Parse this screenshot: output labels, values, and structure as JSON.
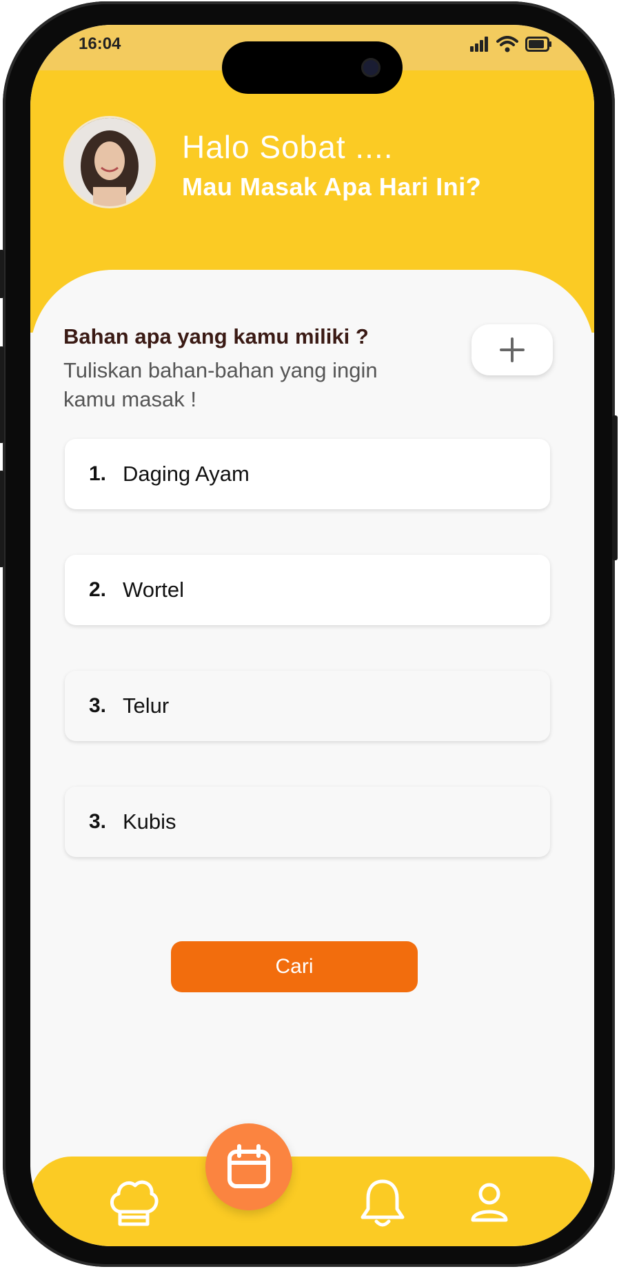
{
  "status_bar": {
    "time": "16:04"
  },
  "header": {
    "greeting": "Halo Sobat ....",
    "subtitle": "Mau Masak Apa Hari Ini?"
  },
  "question": {
    "title": "Bahan apa yang kamu miliki ?",
    "subtitle": "Tuliskan bahan-bahan yang ingin kamu masak !"
  },
  "ingredients": [
    {
      "number": "1.",
      "name": "Daging Ayam"
    },
    {
      "number": "2.",
      "name": "Wortel"
    },
    {
      "number": "3.",
      "name": "Telur"
    },
    {
      "number": "3.",
      "name": "Kubis"
    }
  ],
  "actions": {
    "search_label": "Cari"
  },
  "colors": {
    "header_yellow": "#fbcb24",
    "accent_orange": "#f26d0d",
    "fab_orange": "#fb8440",
    "panel_bg": "#f8f8f8"
  },
  "nav": {
    "icons": [
      "chef-hat-icon",
      "calendar-icon",
      "bell-icon",
      "user-icon"
    ]
  }
}
